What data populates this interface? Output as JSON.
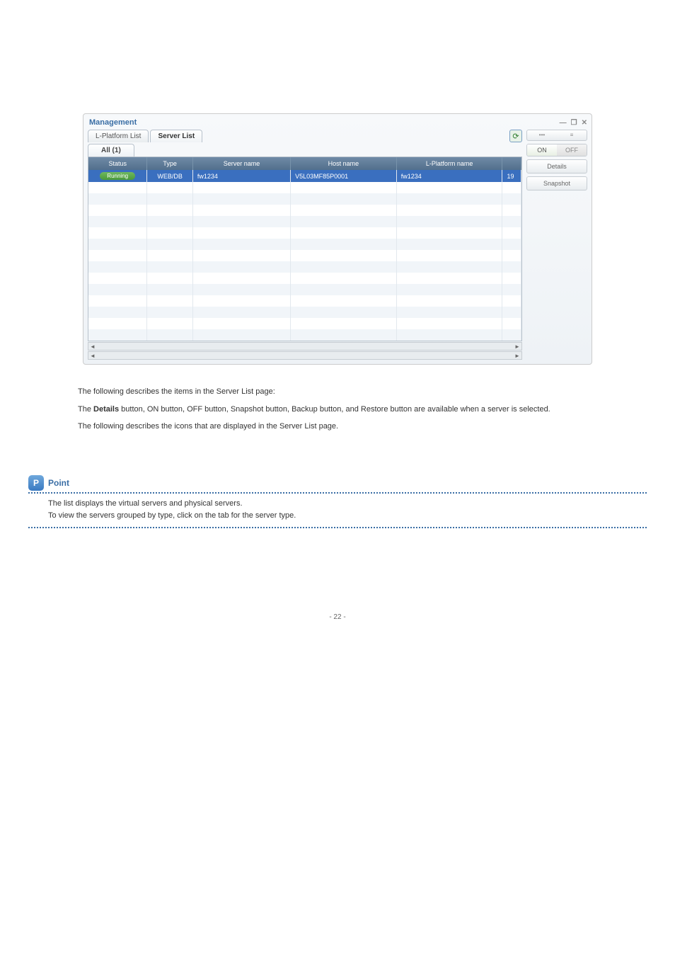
{
  "panel": {
    "title": "Management"
  },
  "tabs": {
    "lplatform": "L-Platform List",
    "serverlist": "Server List"
  },
  "subtab": {
    "all": "All (1)"
  },
  "columns": {
    "status": "Status",
    "type": "Type",
    "server": "Server name",
    "host": "Host name",
    "lp": "L-Platform name"
  },
  "row": {
    "status": "Running",
    "type": "WEB/DB",
    "server": "fw1234",
    "host": "V5L03MF85P0001",
    "lp": "fw1234",
    "last": "19"
  },
  "sidebar": {
    "on": "ON",
    "off": "OFF",
    "details": "Details",
    "snapshot": "Snapshot",
    "mini_left": "•••",
    "mini_right": "≡"
  },
  "doc": {
    "para1": "The following describes the items in the Server List page:",
    "para2_pre": "The ",
    "para2_strong": "Details",
    "para2_post": " button, ON button, OFF button, Snapshot button, Backup button, and Restore button are available when a server is selected.",
    "para3": "The following describes the icons that are displayed in the Server List page."
  },
  "point": {
    "label": "Point",
    "glyph": "P",
    "body1": "The list displays the virtual servers and physical servers.",
    "body2": "To view the servers grouped by type, click on the tab for the server type."
  },
  "footer": "- 22 -"
}
